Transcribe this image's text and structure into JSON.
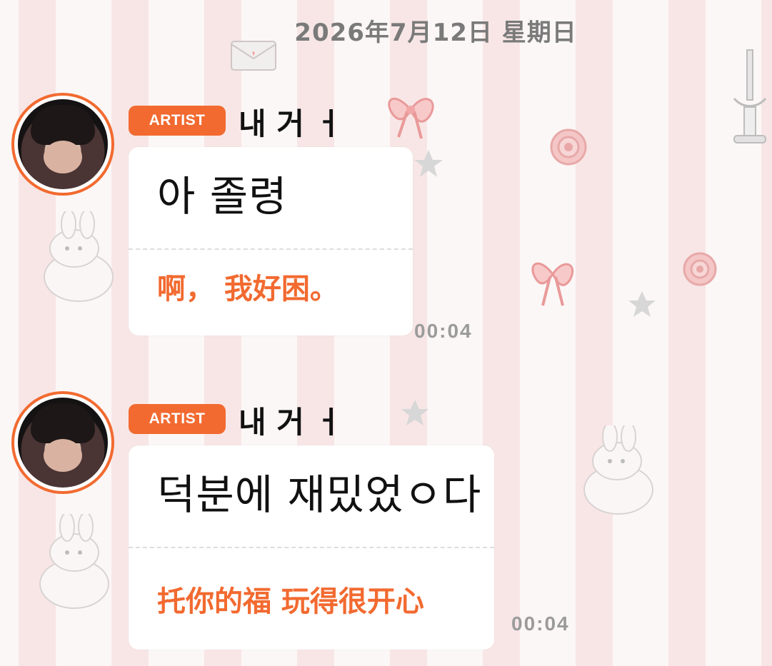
{
  "chat": {
    "date_separator": "2026年7月12日  星期日",
    "messages": [
      {
        "badge": "ARTIST",
        "sender": "내 거 ㅓ",
        "original": "아 졸령",
        "translation": "啊，  我好困。",
        "time": "00:04"
      },
      {
        "badge": "ARTIST",
        "sender": "내 거 ㅓ",
        "original": "덕분에 재밌었ㅇ다",
        "translation": "托你的福 玩得很开心",
        "time": "00:04"
      }
    ]
  },
  "theme": {
    "accent": "#f26a30",
    "timestamp": "#9b9b9b",
    "bubble": "#ffffff",
    "background_stripes": "#f3c4c4"
  },
  "decorations": [
    "bunny-icon",
    "bow-icon",
    "star-icon",
    "rose-icon",
    "envelope-icon",
    "candle-icon"
  ]
}
